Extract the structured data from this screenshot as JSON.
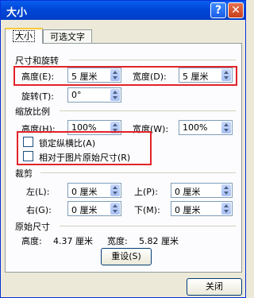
{
  "window": {
    "title": "大小",
    "help_glyph": "?",
    "close_glyph": "✕"
  },
  "tabs": [
    {
      "label": "大小"
    },
    {
      "label": "可选文字"
    }
  ],
  "size_rotate": {
    "heading": "尺寸和旋转",
    "height_label": "高度(E):",
    "height_value": "5 厘米",
    "width_label": "宽度(D):",
    "width_value": "5 厘米",
    "rotate_label": "旋转(T):",
    "rotate_value": "0°"
  },
  "scale": {
    "heading": "缩放比例",
    "height_label": "高度(H):",
    "height_value": "100%",
    "width_label": "宽度(W):",
    "width_value": "100%",
    "lock_aspect_label": "锁定纵横比(A)",
    "relative_label": "相对于图片原始尺寸(R)"
  },
  "crop": {
    "heading": "裁剪",
    "left_label": "左(L):",
    "left_value": "0 厘米",
    "top_label": "上(P):",
    "top_value": "0 厘米",
    "right_label": "右(G):",
    "right_value": "0 厘米",
    "bottom_label": "下(M):",
    "bottom_value": "0 厘米"
  },
  "original": {
    "heading": "原始尺寸",
    "height_label": "高度:",
    "height_value": "4.37 厘米",
    "width_label": "宽度:",
    "width_value": "5.82 厘米",
    "reset_label": "重设(S)"
  },
  "footer": {
    "close_label": "关闭"
  },
  "colors": {
    "highlight": "#e2232a",
    "titlebar": "#0047d6"
  }
}
